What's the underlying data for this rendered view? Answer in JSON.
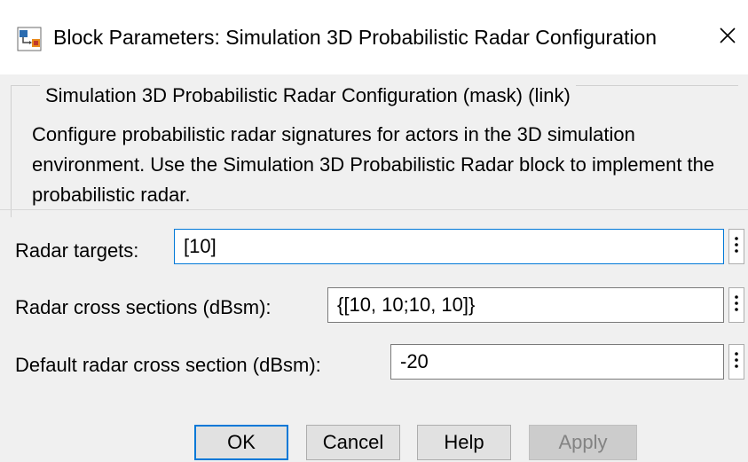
{
  "window": {
    "title": "Block Parameters: Simulation 3D Probabilistic Radar Configuration",
    "close_symbol": "✕",
    "icon": "simulink-block-icon"
  },
  "group": {
    "legend": "Simulation 3D Probabilistic Radar Configuration (mask) (link)",
    "description": "Configure probabilistic radar signatures for actors in the 3D simulation environment. Use the Simulation 3D Probabilistic Radar block to implement the probabilistic radar."
  },
  "params": [
    {
      "label": "Radar targets:",
      "value": "[10]"
    },
    {
      "label": "Radar cross sections (dBsm):",
      "value": "{[10, 10;10, 10]}"
    },
    {
      "label": "Default radar cross section (dBsm):",
      "value": "-20"
    }
  ],
  "buttons": {
    "ok": "OK",
    "cancel": "Cancel",
    "help": "Help",
    "apply": "Apply"
  },
  "colors": {
    "focus_border": "#0078d7",
    "dialog_background": "#f0f0f0",
    "button_face": "#e1e1e1",
    "disabled_text": "#838383"
  }
}
